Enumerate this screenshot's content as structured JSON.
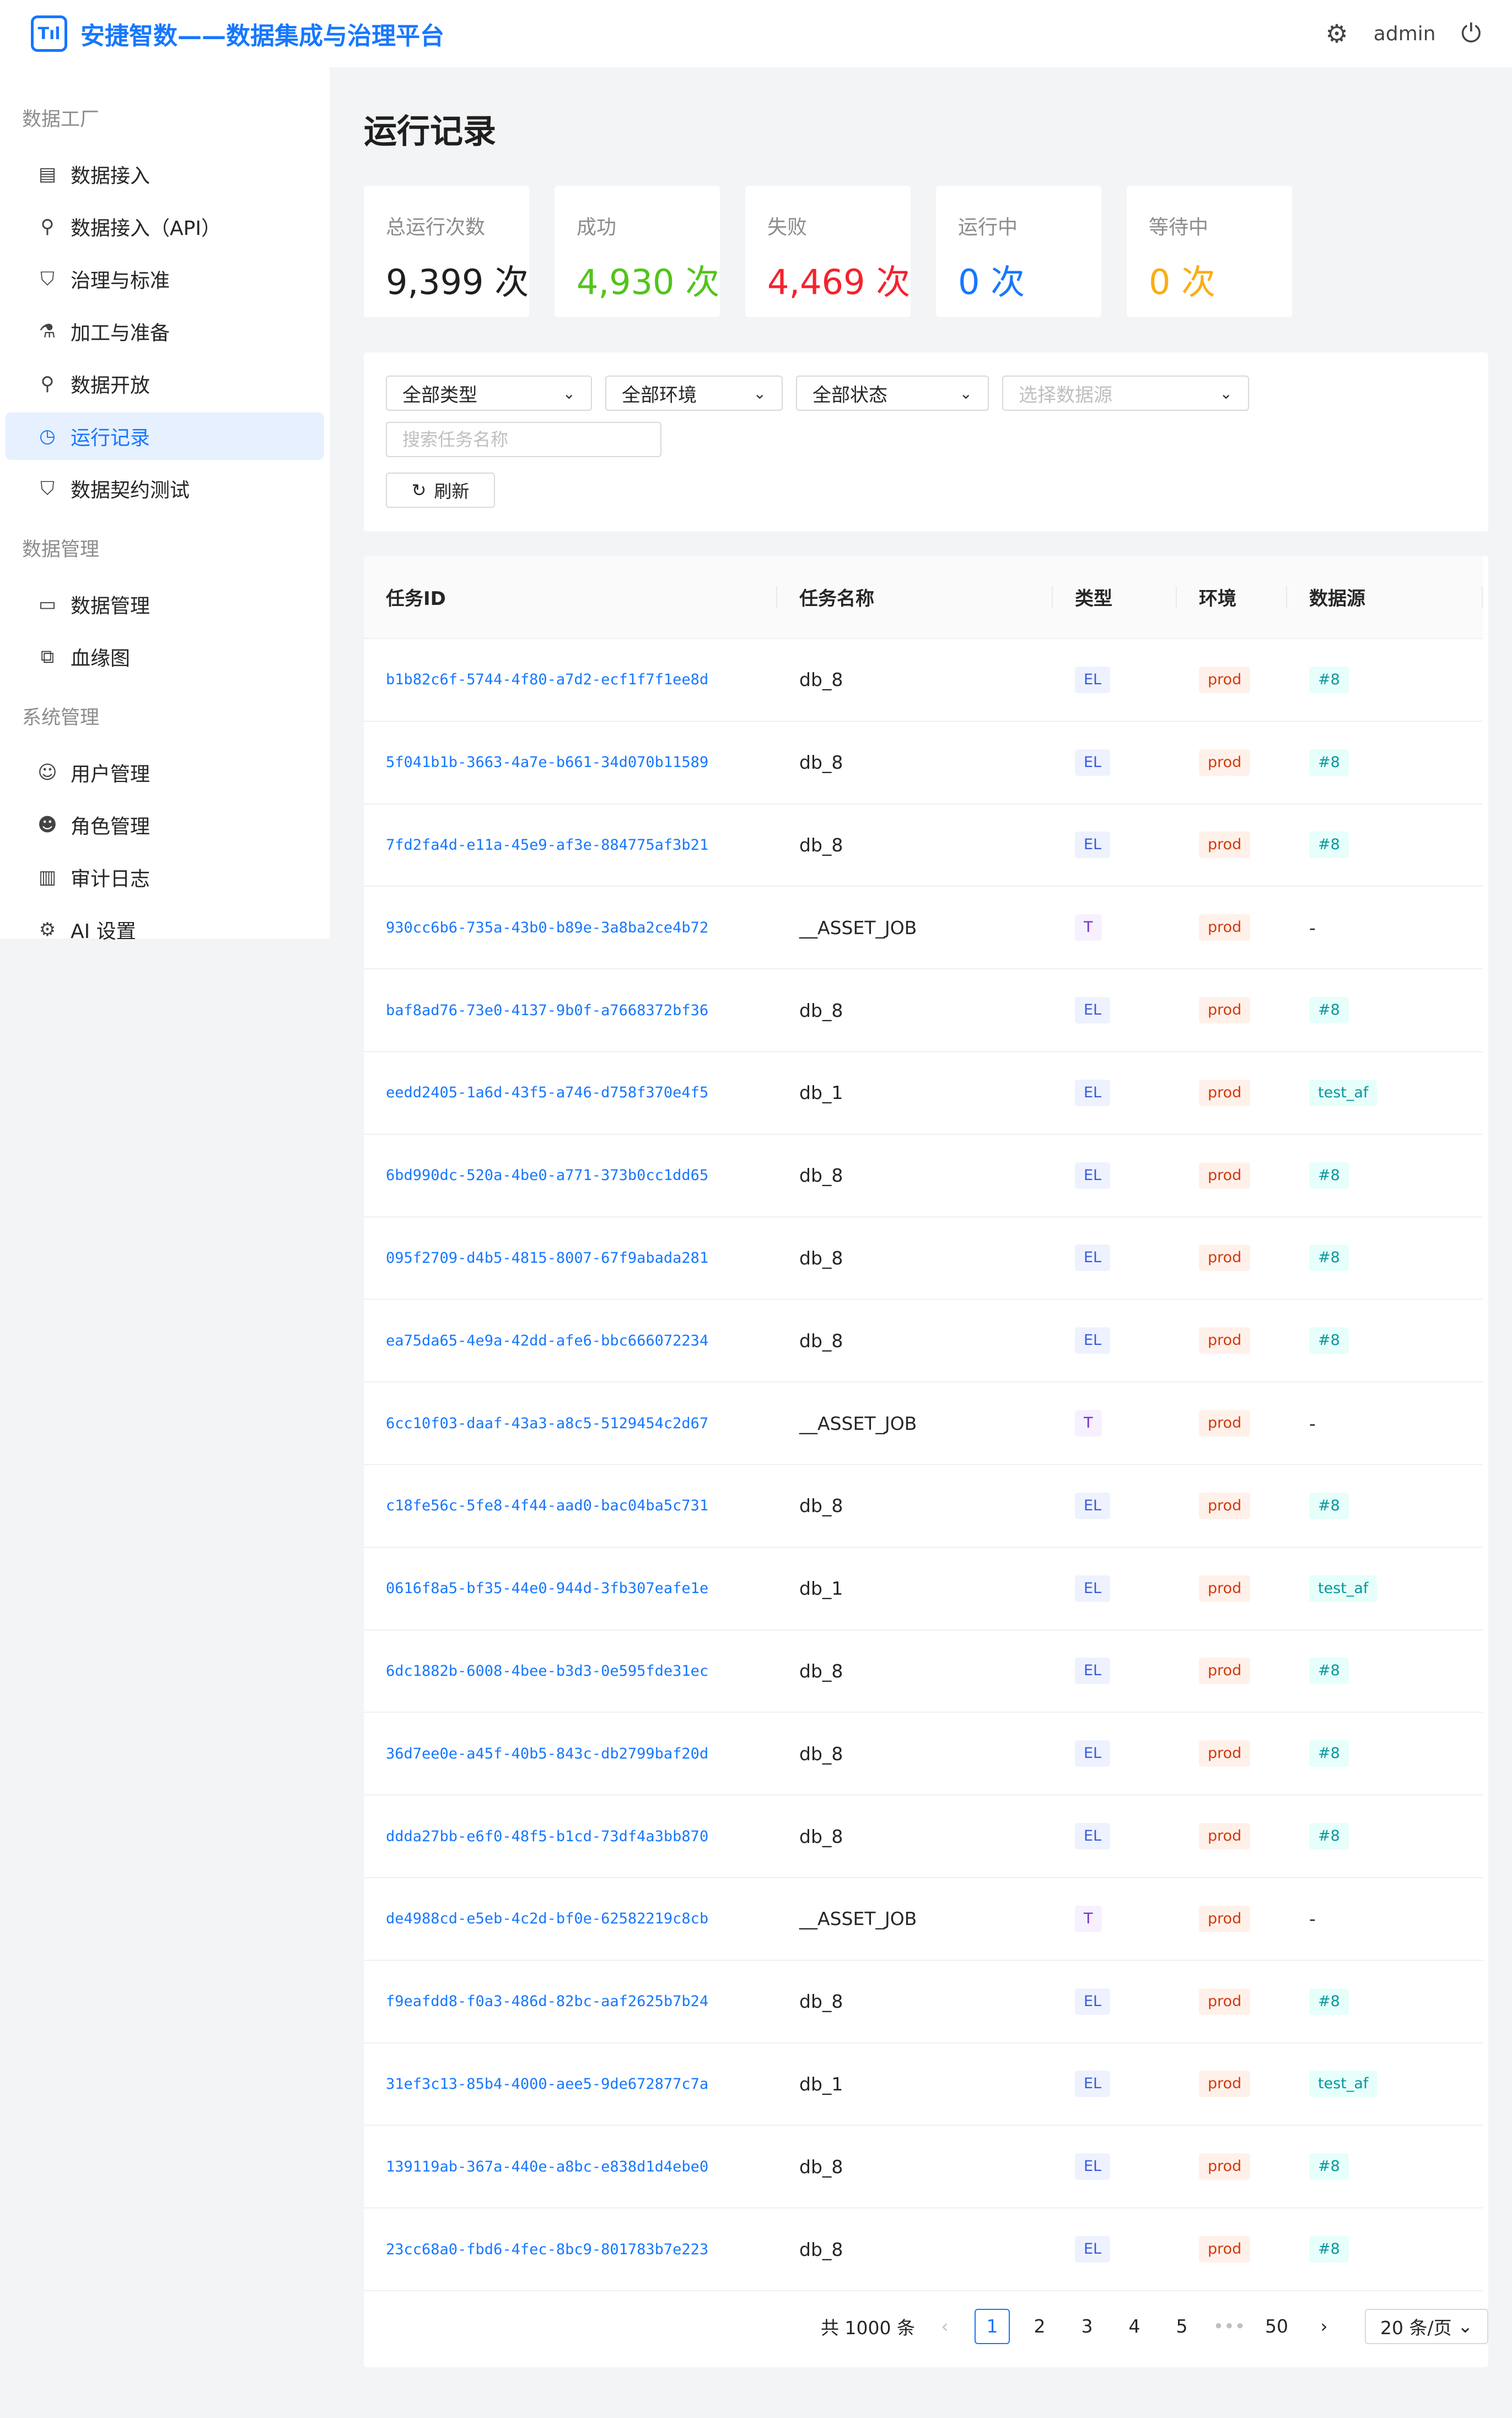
{
  "app": {
    "title": "安捷智数——数据集成与治理平台",
    "logo_text": "Tıl",
    "user": "admin"
  },
  "sidebar": {
    "sections": [
      {
        "title": "数据工厂",
        "items": [
          {
            "label": "数据接入",
            "icon": "database-icon"
          },
          {
            "label": "数据接入（API）",
            "icon": "link-icon"
          },
          {
            "label": "治理与标准",
            "icon": "shield-icon"
          },
          {
            "label": "加工与准备",
            "icon": "flask-icon"
          },
          {
            "label": "数据开放",
            "icon": "link-icon"
          },
          {
            "label": "运行记录",
            "icon": "clock-icon",
            "active": true
          },
          {
            "label": "数据契约测试",
            "icon": "shield-icon"
          }
        ]
      },
      {
        "title": "数据管理",
        "items": [
          {
            "label": "数据管理",
            "icon": "folder-icon"
          },
          {
            "label": "血缘图",
            "icon": "lineage-icon"
          }
        ]
      },
      {
        "title": "系统管理",
        "items": [
          {
            "label": "用户管理",
            "icon": "user-icon"
          },
          {
            "label": "角色管理",
            "icon": "users-icon"
          },
          {
            "label": "审计日志",
            "icon": "audit-icon"
          },
          {
            "label": "AI 设置",
            "icon": "gear-icon"
          }
        ]
      }
    ]
  },
  "page": {
    "title": "运行记录"
  },
  "stats": [
    {
      "label": "总运行次数",
      "value": "9,399 次",
      "color": "default"
    },
    {
      "label": "成功",
      "value": "4,930 次",
      "color": "green"
    },
    {
      "label": "失败",
      "value": "4,469 次",
      "color": "red"
    },
    {
      "label": "运行中",
      "value": "0 次",
      "color": "blue"
    },
    {
      "label": "等待中",
      "value": "0 次",
      "color": "orange"
    }
  ],
  "filters": {
    "type": "全部类型",
    "env": "全部环境",
    "status": "全部状态",
    "datasource_placeholder": "选择数据源",
    "search_placeholder": "搜索任务名称",
    "refresh_label": "刷新"
  },
  "table": {
    "columns": [
      "任务ID",
      "任务名称",
      "类型",
      "环境",
      "数据源"
    ],
    "rows": [
      {
        "id": "b1b82c6f-5744-4f80-a7d2-ecf1f7f1ee8d",
        "name": "db_8",
        "type": "EL",
        "env": "prod",
        "ds": "#8"
      },
      {
        "id": "5f041b1b-3663-4a7e-b661-34d070b11589",
        "name": "db_8",
        "type": "EL",
        "env": "prod",
        "ds": "#8"
      },
      {
        "id": "7fd2fa4d-e11a-45e9-af3e-884775af3b21",
        "name": "db_8",
        "type": "EL",
        "env": "prod",
        "ds": "#8"
      },
      {
        "id": "930cc6b6-735a-43b0-b89e-3a8ba2ce4b72",
        "name": "__ASSET_JOB",
        "type": "T",
        "env": "prod",
        "ds": "-"
      },
      {
        "id": "baf8ad76-73e0-4137-9b0f-a7668372bf36",
        "name": "db_8",
        "type": "EL",
        "env": "prod",
        "ds": "#8"
      },
      {
        "id": "eedd2405-1a6d-43f5-a746-d758f370e4f5",
        "name": "db_1",
        "type": "EL",
        "env": "prod",
        "ds": "test_af"
      },
      {
        "id": "6bd990dc-520a-4be0-a771-373b0cc1dd65",
        "name": "db_8",
        "type": "EL",
        "env": "prod",
        "ds": "#8"
      },
      {
        "id": "095f2709-d4b5-4815-8007-67f9abada281",
        "name": "db_8",
        "type": "EL",
        "env": "prod",
        "ds": "#8"
      },
      {
        "id": "ea75da65-4e9a-42dd-afe6-bbc666072234",
        "name": "db_8",
        "type": "EL",
        "env": "prod",
        "ds": "#8"
      },
      {
        "id": "6cc10f03-daaf-43a3-a8c5-5129454c2d67",
        "name": "__ASSET_JOB",
        "type": "T",
        "env": "prod",
        "ds": "-"
      },
      {
        "id": "c18fe56c-5fe8-4f44-aad0-bac04ba5c731",
        "name": "db_8",
        "type": "EL",
        "env": "prod",
        "ds": "#8"
      },
      {
        "id": "0616f8a5-bf35-44e0-944d-3fb307eafe1e",
        "name": "db_1",
        "type": "EL",
        "env": "prod",
        "ds": "test_af"
      },
      {
        "id": "6dc1882b-6008-4bee-b3d3-0e595fde31ec",
        "name": "db_8",
        "type": "EL",
        "env": "prod",
        "ds": "#8"
      },
      {
        "id": "36d7ee0e-a45f-40b5-843c-db2799baf20d",
        "name": "db_8",
        "type": "EL",
        "env": "prod",
        "ds": "#8"
      },
      {
        "id": "ddda27bb-e6f0-48f5-b1cd-73df4a3bb870",
        "name": "db_8",
        "type": "EL",
        "env": "prod",
        "ds": "#8"
      },
      {
        "id": "de4988cd-e5eb-4c2d-bf0e-62582219c8cb",
        "name": "__ASSET_JOB",
        "type": "T",
        "env": "prod",
        "ds": "-"
      },
      {
        "id": "f9eafdd8-f0a3-486d-82bc-aaf2625b7b24",
        "name": "db_8",
        "type": "EL",
        "env": "prod",
        "ds": "#8"
      },
      {
        "id": "31ef3c13-85b4-4000-aee5-9de672877c7a",
        "name": "db_1",
        "type": "EL",
        "env": "prod",
        "ds": "test_af"
      },
      {
        "id": "139119ab-367a-440e-a8bc-e838d1d4ebe0",
        "name": "db_8",
        "type": "EL",
        "env": "prod",
        "ds": "#8"
      },
      {
        "id": "23cc68a0-fbd6-4fec-8bc9-801783b7e223",
        "name": "db_8",
        "type": "EL",
        "env": "prod",
        "ds": "#8"
      }
    ]
  },
  "pagination": {
    "total": "共 1000 条",
    "pages": [
      "1",
      "2",
      "3",
      "4",
      "5",
      "•••",
      "50"
    ],
    "current": "1",
    "page_size": "20 条/页"
  }
}
